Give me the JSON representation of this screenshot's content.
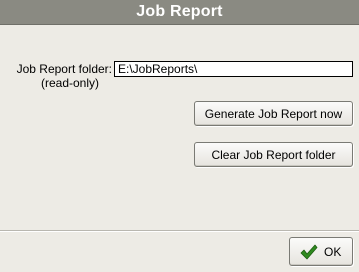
{
  "dialog": {
    "title": "Job Report",
    "folder_label_line1": "Job Report folder:",
    "folder_label_line2": "(read-only)",
    "folder_value": "E:\\JobReports\\",
    "generate_label": "Generate Job Report now",
    "clear_label": "Clear Job Report folder",
    "ok_label": "OK",
    "ok_icon": "checkmark-icon",
    "ok_icon_color": "#2f8a1f",
    "title_bar_color": "#8a8a82"
  }
}
